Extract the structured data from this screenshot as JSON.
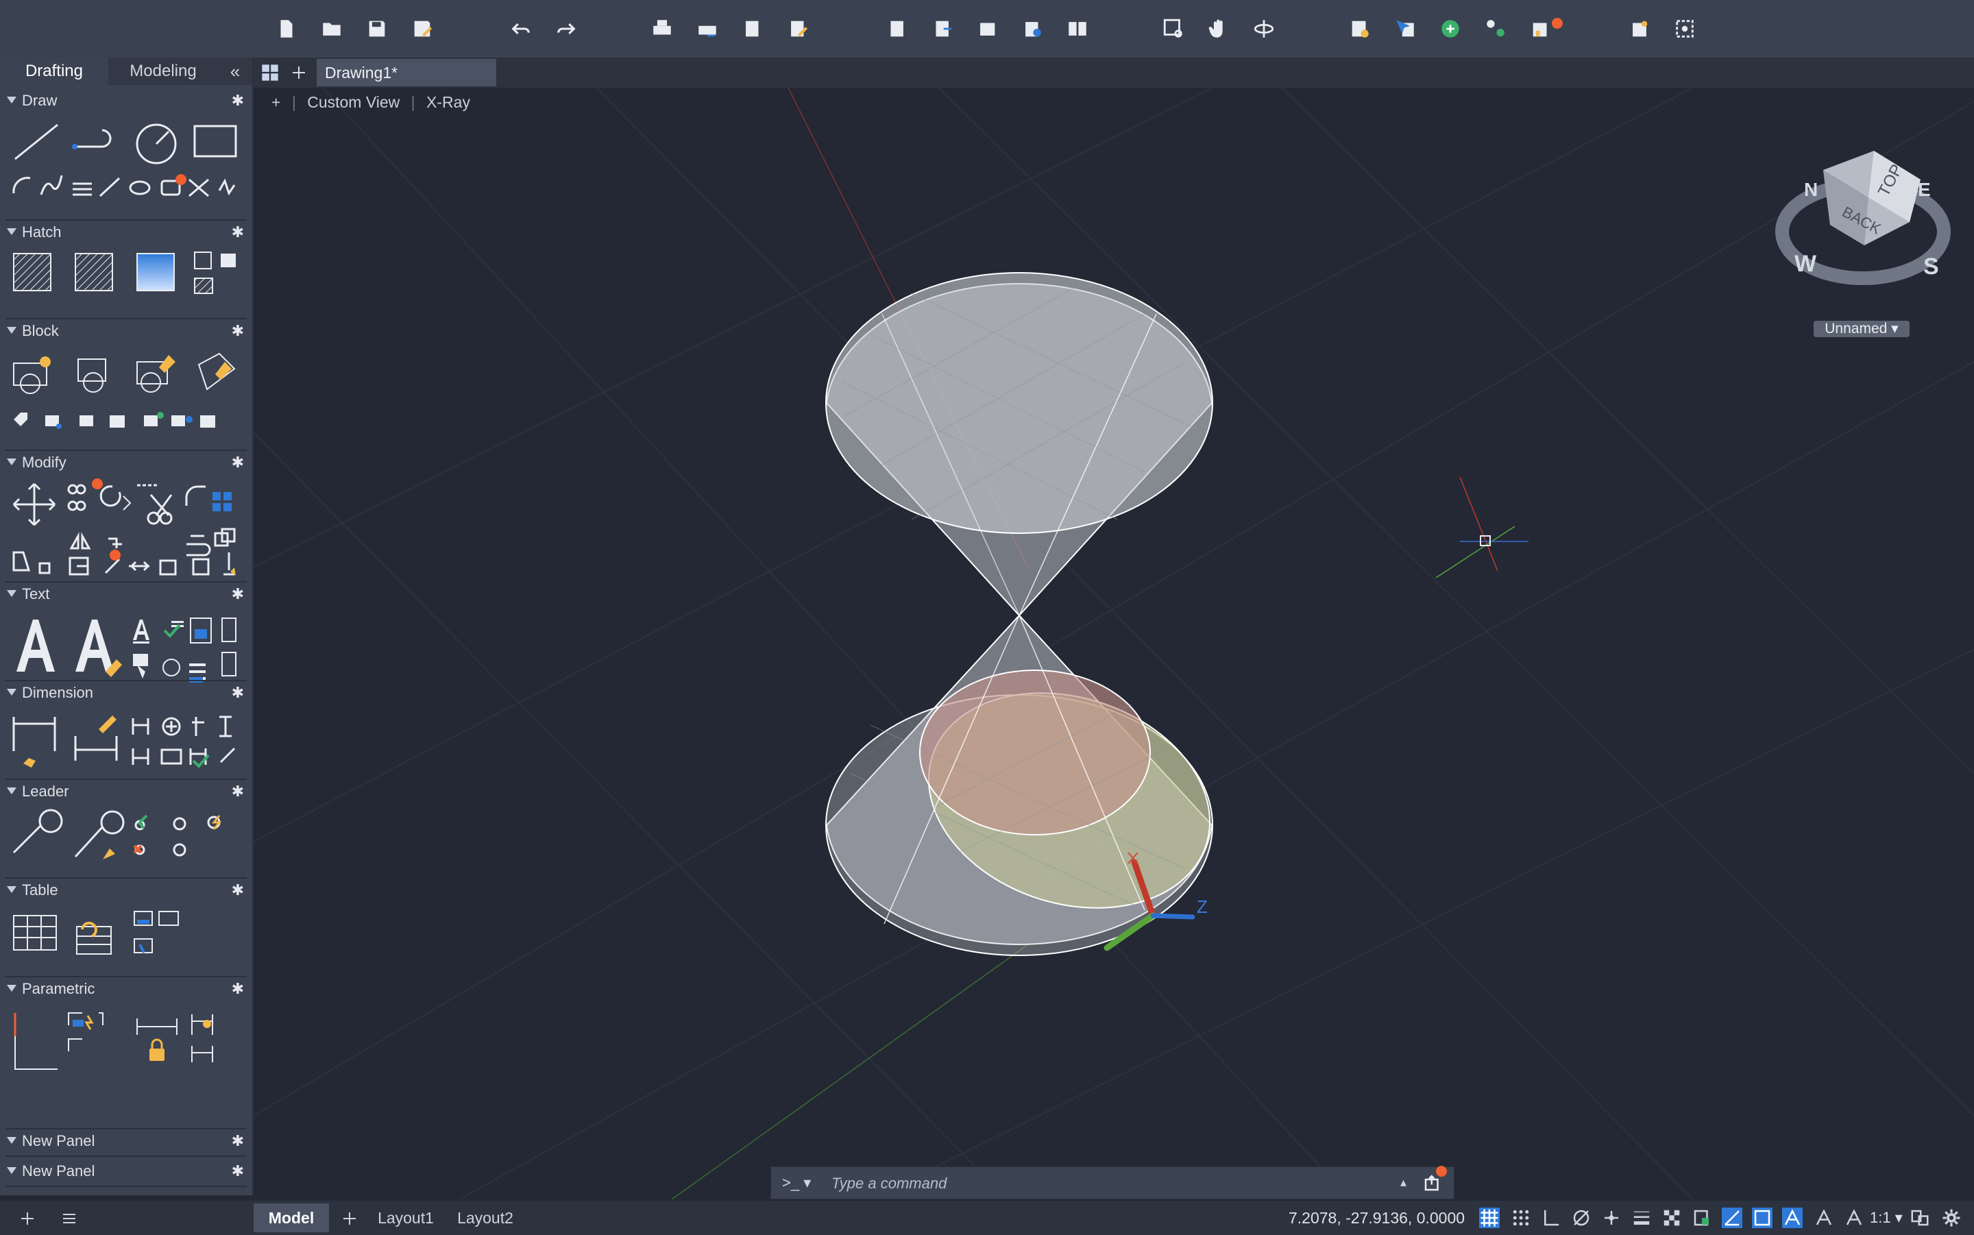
{
  "palette": {
    "tabs": [
      "Drafting",
      "Modeling"
    ],
    "collapse_glyph": "«",
    "panels": [
      {
        "name": "Draw"
      },
      {
        "name": "Hatch"
      },
      {
        "name": "Block"
      },
      {
        "name": "Modify"
      },
      {
        "name": "Text"
      },
      {
        "name": "Dimension"
      },
      {
        "name": "Leader"
      },
      {
        "name": "Table"
      },
      {
        "name": "Parametric"
      },
      {
        "name": "New Panel"
      },
      {
        "name": "New Panel"
      }
    ]
  },
  "doc_tabs": {
    "active": "Drawing1*"
  },
  "viewport": {
    "controls": "+",
    "view": "Custom View",
    "style": "X-Ray",
    "viewcube_faces": [
      "BACK",
      "TOP"
    ],
    "compass": [
      "W",
      "S",
      "N",
      "E"
    ],
    "named_view": "Unnamed",
    "ucs_z_label": "Z"
  },
  "command": {
    "prompt": ">_",
    "placeholder": "Type a command"
  },
  "status": {
    "layout_tabs": [
      "Model",
      "Layout1",
      "Layout2"
    ],
    "coords": "7.2078,  -27.9136, 0.0000",
    "scale": "1:1"
  },
  "colors": {
    "accent": "#2f7ad8",
    "badge": "#f06030",
    "canvas": "#232834"
  }
}
